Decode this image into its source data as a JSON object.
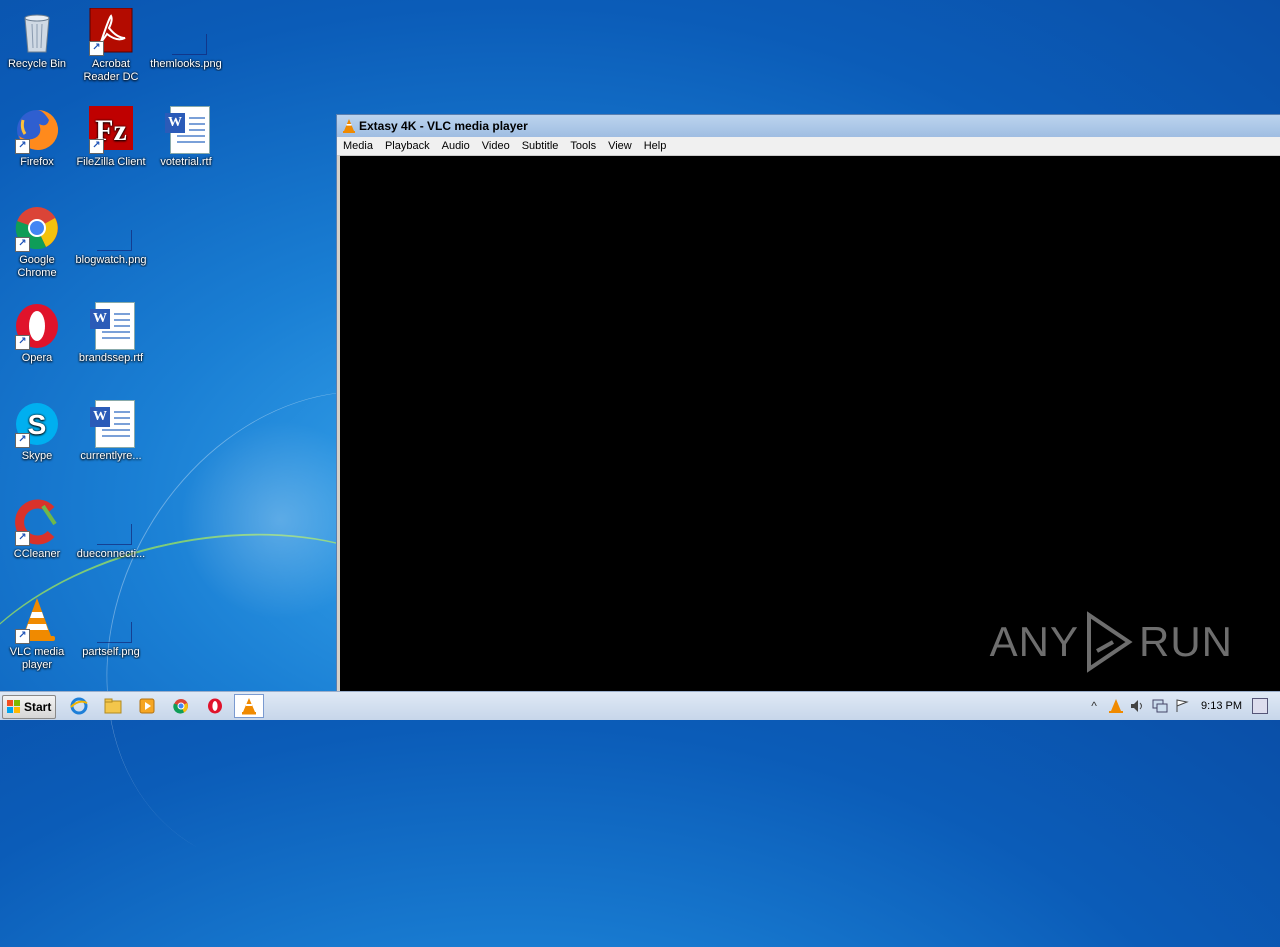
{
  "desktop": {
    "icons": [
      {
        "label": "Recycle Bin"
      },
      {
        "label": "Acrobat Reader DC"
      },
      {
        "label": "themlooks.png"
      },
      {
        "label": "Firefox"
      },
      {
        "label": "FileZilla Client"
      },
      {
        "label": "votetrial.rtf"
      },
      {
        "label": "Google Chrome"
      },
      {
        "label": "blogwatch.png"
      },
      {
        "label": "Opera"
      },
      {
        "label": "brandssep.rtf"
      },
      {
        "label": "Skype"
      },
      {
        "label": "currentlyre..."
      },
      {
        "label": "CCleaner"
      },
      {
        "label": "dueconnecti..."
      },
      {
        "label": "VLC media player"
      },
      {
        "label": "partself.png"
      }
    ]
  },
  "vlc_window": {
    "title": "Extasy 4K - VLC media player",
    "menu": [
      "Media",
      "Playback",
      "Audio",
      "Video",
      "Subtitle",
      "Tools",
      "View",
      "Help"
    ]
  },
  "watermark": {
    "left": "ANY",
    "right": "RUN"
  },
  "taskbar": {
    "start_label": "Start",
    "clock": "9:13 PM",
    "tray_expand": "^"
  },
  "colors": {
    "accent": "#1a7fd4",
    "vlc_orange": "#f08a00"
  }
}
